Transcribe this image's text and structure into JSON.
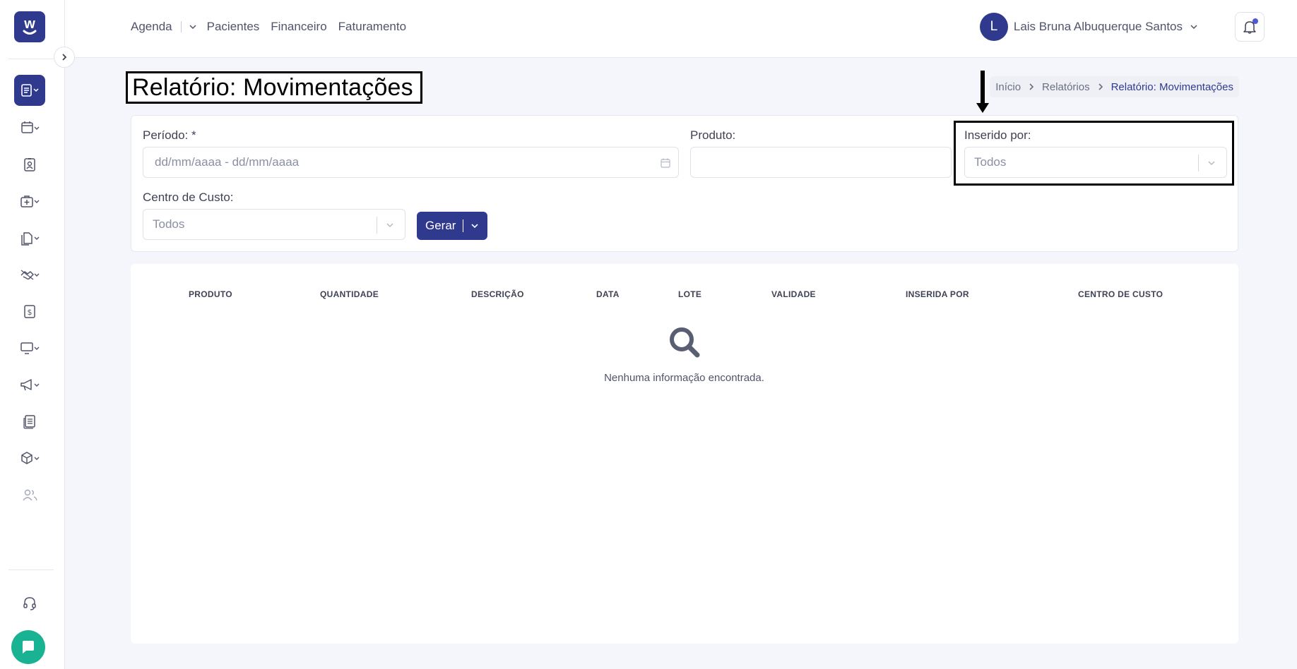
{
  "app": {
    "logo_letter": "w",
    "brand_color": "#2f3a8f",
    "accent_color": "#19b394"
  },
  "sidebar": {
    "items": [
      {
        "icon": "report-icon",
        "active": true,
        "has_caret": true
      },
      {
        "icon": "calendar-icon",
        "has_caret": true
      },
      {
        "icon": "patient-id-icon",
        "has_caret": false
      },
      {
        "icon": "medical-kit-icon",
        "has_caret": true
      },
      {
        "icon": "documents-icon",
        "has_caret": true
      },
      {
        "icon": "handshake-icon",
        "has_caret": true
      },
      {
        "icon": "billing-icon",
        "has_caret": false
      },
      {
        "icon": "monitor-icon",
        "has_caret": true
      },
      {
        "icon": "megaphone-icon",
        "has_caret": true
      },
      {
        "icon": "news-icon",
        "has_caret": false
      },
      {
        "icon": "package-icon",
        "has_caret": true
      },
      {
        "icon": "users-icon",
        "has_caret": false
      }
    ],
    "support_icon": "headset-icon",
    "chat_icon": "chat-icon"
  },
  "topnav": {
    "agenda": "Agenda",
    "pacientes": "Pacientes",
    "financeiro": "Financeiro",
    "faturamento": "Faturamento"
  },
  "user": {
    "initial": "L",
    "name": "Lais Bruna Albuquerque Santos",
    "has_notification": true
  },
  "page": {
    "title": "Relatório: Movimentações"
  },
  "breadcrumb": {
    "home": "Início",
    "reports": "Relatórios",
    "current": "Relatório: Movimentações"
  },
  "filters": {
    "periodo_label": "Período: *",
    "periodo_placeholder": "dd/mm/aaaa - dd/mm/aaaa",
    "produto_label": "Produto:",
    "produto_value": "",
    "inserido_label": "Inserido por:",
    "inserido_value": "Todos",
    "centro_label": "Centro de Custo:",
    "centro_value": "Todos",
    "gerar_label": "Gerar"
  },
  "table": {
    "columns": [
      "PRODUTO",
      "QUANTIDADE",
      "DESCRIÇÃO",
      "DATA",
      "LOTE",
      "VALIDADE",
      "INSERIDA POR",
      "CENTRO DE CUSTO"
    ],
    "empty_message": "Nenhuma informação encontrada."
  }
}
